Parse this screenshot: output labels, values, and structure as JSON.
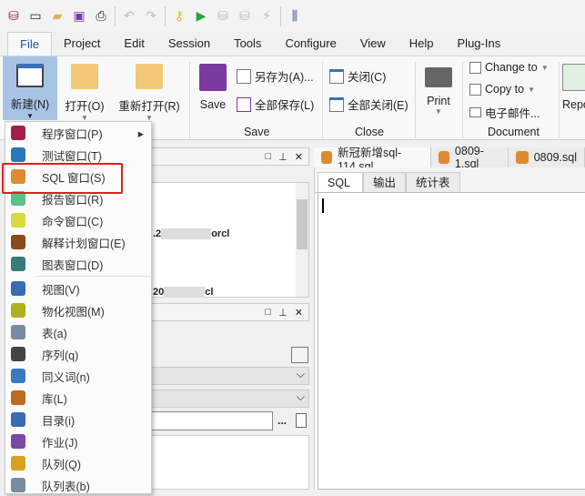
{
  "quick_access": {
    "icons": [
      "database-icon",
      "new-window-icon",
      "open-folder-icon",
      "save-icon",
      "print-icon",
      "undo-icon",
      "redo-icon",
      "key-icon",
      "run-icon",
      "commit-icon",
      "rollback-icon",
      "break-icon",
      "settings-icon"
    ]
  },
  "menu_tabs": [
    "File",
    "Project",
    "Edit",
    "Session",
    "Tools",
    "Configure",
    "View",
    "Help",
    "Plug-Ins"
  ],
  "ribbon": {
    "new_label": "新建(N)",
    "open_label": "打开(O)",
    "reopen_label": "重新打开(R)",
    "save_label": "Save",
    "save_as_label": "另存为(A)...",
    "save_all_label": "全部保存(L)",
    "close_label": "关闭(C)",
    "close_all_label": "全部关闭(E)",
    "print_label": "Print",
    "change_to_label": "Change to",
    "copy_to_label": "Copy to",
    "email_label": "电子邮件...",
    "report_label": "Repo",
    "groups": {
      "save": "Save",
      "close": "Close",
      "document": "Document"
    }
  },
  "new_menu": {
    "items": [
      {
        "label": "程序窗口(P)",
        "color": "#a0204a",
        "submenu": true
      },
      {
        "label": "测试窗口(T)",
        "color": "#2a78b8"
      },
      {
        "label": "SQL 窗口(S)",
        "color": "#e08a30",
        "highlighted": true
      },
      {
        "label": "报告窗口(R)",
        "color": "#5cc08a"
      },
      {
        "label": "命令窗口(C)",
        "color": "#d8d840"
      },
      {
        "label": "解释计划窗口(E)",
        "color": "#8a4a1a"
      },
      {
        "label": "图表窗口(D)",
        "color": "#3a7a78"
      },
      {
        "label": "视图(V)",
        "color": "#3a6ab0",
        "sep_before": true
      },
      {
        "label": "物化视图(M)",
        "color": "#b0b020"
      },
      {
        "label": "表(a)",
        "color": "#7a8aa0"
      },
      {
        "label": "序列(q)",
        "color": "#444"
      },
      {
        "label": "同义词(n)",
        "color": "#3a7ac0"
      },
      {
        "label": "库(L)",
        "color": "#c06a20"
      },
      {
        "label": "目录(i)",
        "color": "#3a6ab0"
      },
      {
        "label": "作业(J)",
        "color": "#7a4aa0"
      },
      {
        "label": "队列(Q)",
        "color": "#d8a020"
      },
      {
        "label": "队列表(b)",
        "color": "#7a8aa0"
      }
    ]
  },
  "connections": {
    "row1": ".2",
    "row1_suffix": "orcl",
    "row2": "20",
    "row2_suffix": "cl"
  },
  "doc_tabs": [
    "新冠新增sql-114.sql",
    "0809-1.sql",
    "0809.sql"
  ],
  "editor_tabs": [
    "SQL",
    "输出",
    "统计表"
  ],
  "highlight_color": "#e02020"
}
